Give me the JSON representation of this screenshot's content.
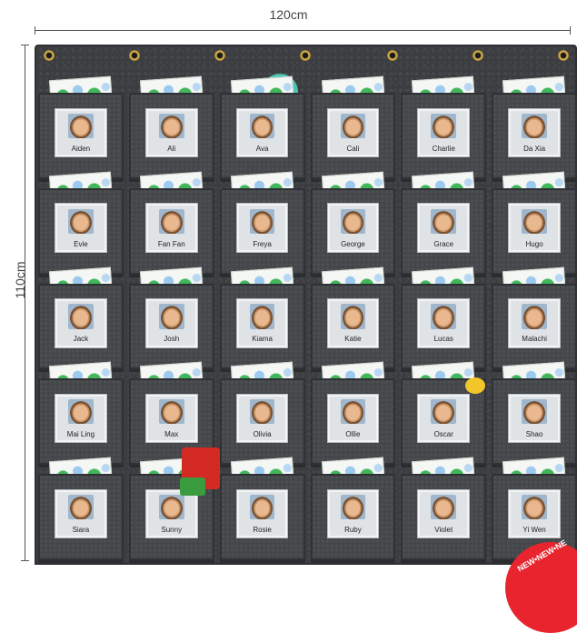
{
  "dimensions": {
    "width": "120cm",
    "height": "110cm"
  },
  "badge_text": "NEW•NEW•NE",
  "colors": {
    "felt": "#3b3d40",
    "card_dot_green": "#41b65a",
    "card_dot_blue": "#9cc9ee",
    "badge": "#e8252e"
  },
  "pockets": [
    [
      "Aiden",
      "Ali",
      "Ava",
      "Cali",
      "Charlie",
      "Da Xia"
    ],
    [
      "Evie",
      "Fan Fan",
      "Freya",
      "George",
      "Grace",
      "Hugo"
    ],
    [
      "Jack",
      "Josh",
      "Kiama",
      "Katie",
      "Lucas",
      "Malachi"
    ],
    [
      "Mai Ling",
      "Max",
      "Olivia",
      "Ollie",
      "Oscar",
      "Shao"
    ],
    [
      "Siara",
      "Sunny",
      "Rosie",
      "Ruby",
      "Violet",
      "Yi Wen"
    ]
  ]
}
